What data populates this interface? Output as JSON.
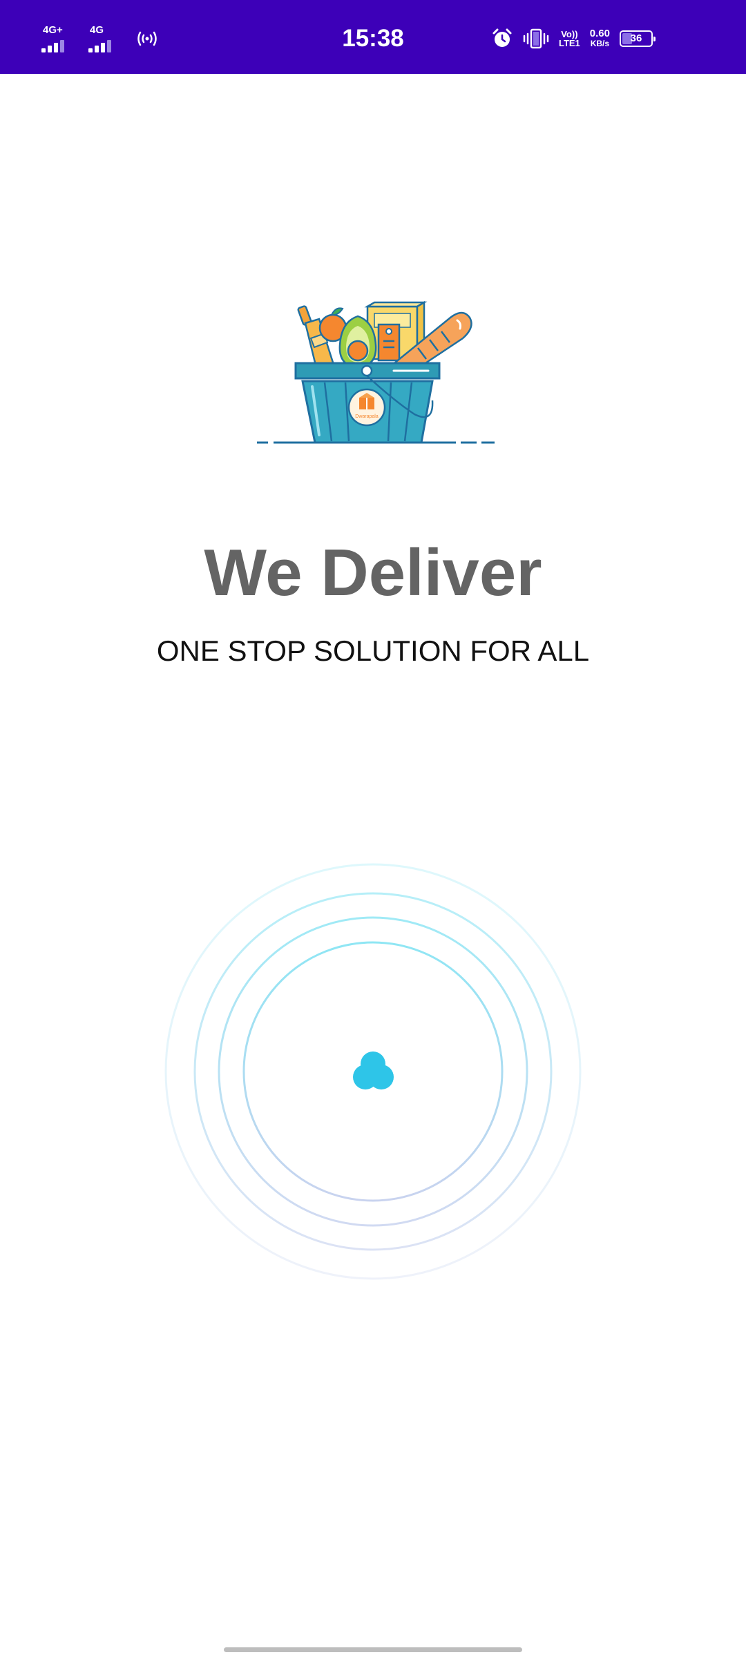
{
  "status_bar": {
    "network1": "4G+",
    "network1_bars_filled": 3,
    "network2": "4G",
    "network2_bars_filled": 3,
    "hotspot_icon": "hotspot-icon",
    "time": "15:38",
    "alarm_icon": "alarm-icon",
    "vibrate_icon": "vibrate-icon",
    "volte_top": "Vo))",
    "volte_bottom": "LTE1",
    "speed_value": "0.60",
    "speed_unit": "KB/s",
    "battery_level": "36",
    "background_color": "#3d00b8"
  },
  "splash": {
    "logo_icon": "grocery-basket-icon",
    "logo_text": "Dwarapala",
    "headline": "We Deliver",
    "tagline": "ONE STOP SOLUTION FOR ALL"
  },
  "loader": {
    "icon": "loading-blob-icon",
    "accent_color": "#2ec5e8"
  }
}
